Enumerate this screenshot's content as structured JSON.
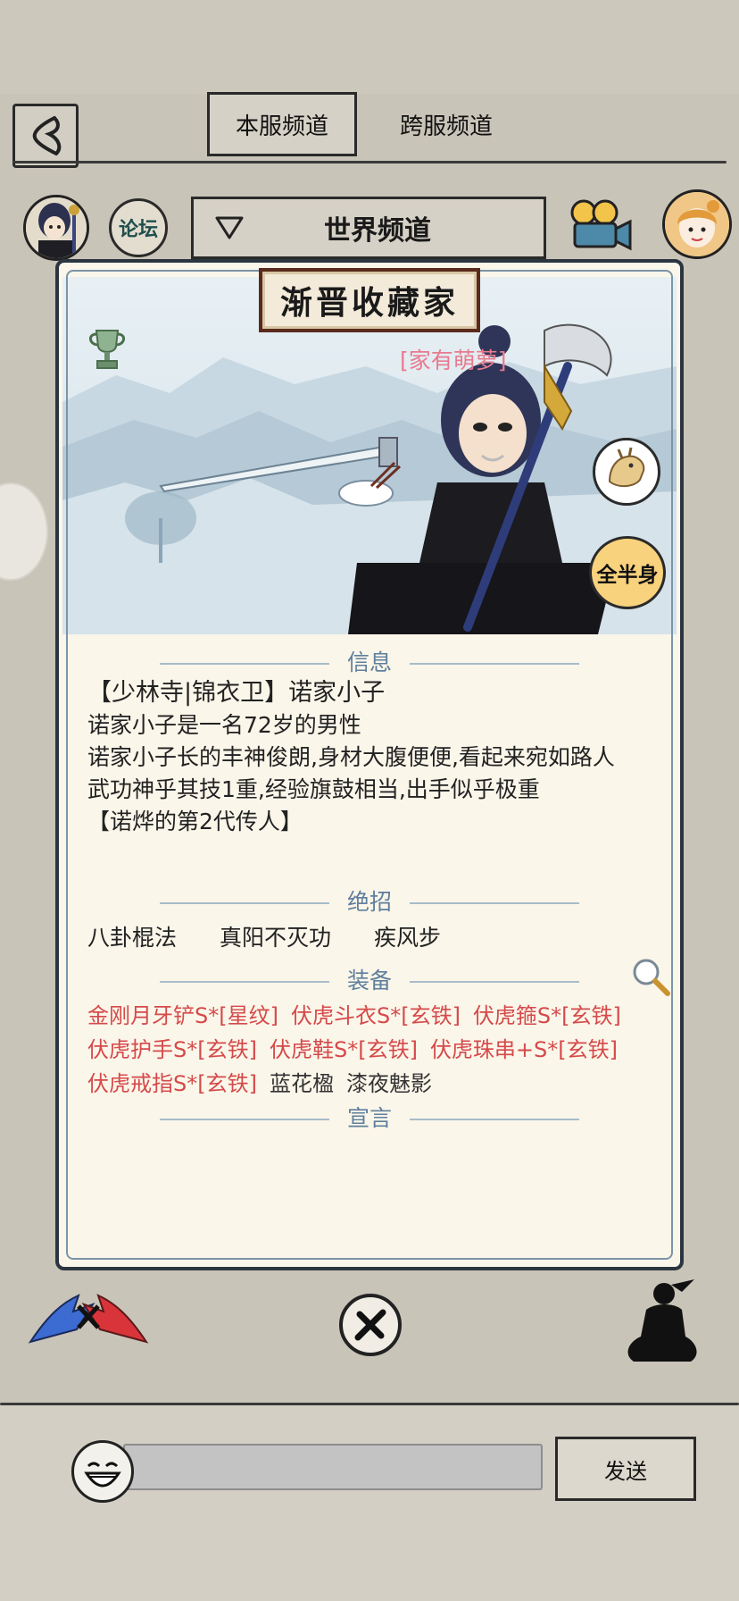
{
  "tabs": {
    "local": "本服频道",
    "cross": "跨服频道"
  },
  "forum_label": "论坛",
  "channel": {
    "selected": "世界频道"
  },
  "profile": {
    "title": "渐晋收藏家",
    "family_tag": "[家有萌萝]",
    "fullbody_label": "全半身"
  },
  "sections": {
    "info": "信息",
    "skills": "绝招",
    "equipment": "装备",
    "declaration": "宣言"
  },
  "info_lines": [
    "【少林寺|锦衣卫】诺家小子",
    "诺家小子是一名72岁的男性",
    "诺家小子长的丰神俊朗,身材大腹便便,看起来宛如路人",
    "武功神乎其技1重,经验旗鼓相当,出手似乎极重",
    "【诺烨的第2代传人】"
  ],
  "skills": [
    "八卦棍法",
    "真阳不灭功",
    "疾风步"
  ],
  "equipment": [
    {
      "name": "金刚月牙铲S*[星纹]",
      "color": "#d54a4a"
    },
    {
      "name": "伏虎斗衣S*[玄铁]",
      "color": "#d54a4a"
    },
    {
      "name": "伏虎箍S*[玄铁]",
      "color": "#d54a4a"
    },
    {
      "name": "伏虎护手S*[玄铁]",
      "color": "#d54a4a"
    },
    {
      "name": "伏虎鞋S*[玄铁]",
      "color": "#d54a4a"
    },
    {
      "name": "伏虎珠串+S*[玄铁]",
      "color": "#d54a4a"
    },
    {
      "name": "伏虎戒指S*[玄铁]",
      "color": "#d54a4a"
    },
    {
      "name": "蓝花楹",
      "color": "#333333"
    },
    {
      "name": "漆夜魅影",
      "color": "#333333"
    }
  ],
  "chat": {
    "send_label": "发送",
    "input_value": ""
  },
  "icons": {
    "back": "chevron-left-icon",
    "trophy": "trophy-icon",
    "camera": "movie-camera-icon",
    "magnifier": "magnifier-icon",
    "close": "close-icon",
    "pk": "versus-icon",
    "meditate": "meditate-icon",
    "emoji": "laughing-face-icon"
  }
}
